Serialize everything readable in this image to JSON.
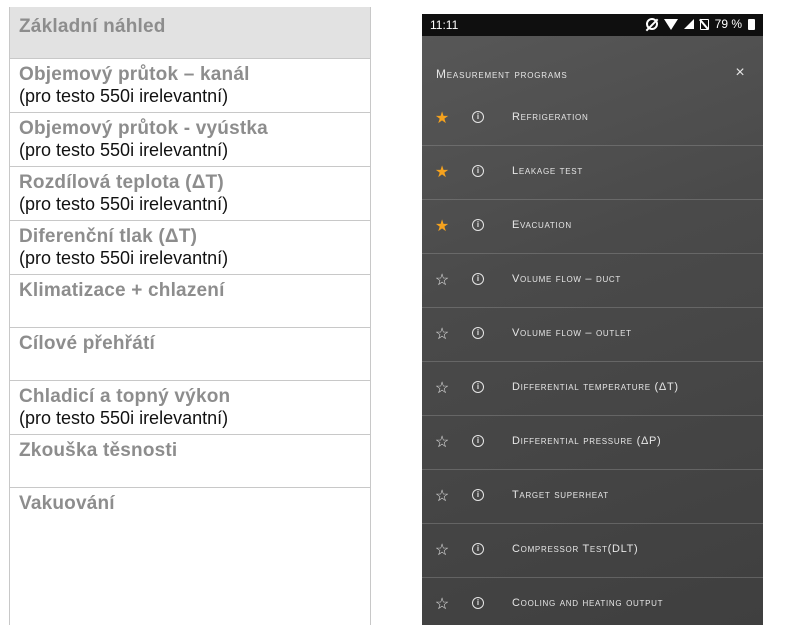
{
  "doc": {
    "header": "Základní náhled",
    "rows": [
      {
        "title": "Objemový průtok – kanál",
        "note": "(pro testo 550i irelevantní)"
      },
      {
        "title": "Objemový průtok - vyústka",
        "note": "(pro testo 550i irelevantní)"
      },
      {
        "title": "Rozdílová teplota (ΔT)",
        "note": "(pro testo 550i irelevantní)"
      },
      {
        "title": "Diferenční tlak (ΔT)",
        "note": "(pro testo 550i irelevantní)"
      },
      {
        "title": "Klimatizace + chlazení",
        "note": ""
      },
      {
        "title": "Cílové přehřátí",
        "note": ""
      },
      {
        "title": "Chladicí a topný výkon",
        "note": "(pro testo 550i irelevantní)"
      },
      {
        "title": "Zkouška těsnosti",
        "note": ""
      },
      {
        "title": "Vakuování",
        "note": ""
      }
    ]
  },
  "phone": {
    "status": {
      "time": "11:11",
      "battery": "79 %",
      "icons": [
        "alarm-off-icon",
        "wifi-icon",
        "signal-icon",
        "no-sim-icon",
        "battery-icon"
      ]
    },
    "title": "Measurement programs",
    "close_glyph": "×",
    "info_glyph": "i",
    "star_filled": "★",
    "star_empty": "☆",
    "accent_color": "#f5a21e",
    "programs": [
      {
        "label": "Refrigeration",
        "favorite": true
      },
      {
        "label": "Leakage test",
        "favorite": true
      },
      {
        "label": "Evacuation",
        "favorite": true
      },
      {
        "label": "Volume flow – duct",
        "favorite": false
      },
      {
        "label": "Volume flow – outlet",
        "favorite": false
      },
      {
        "label": "Differential temperature (ΔT)",
        "favorite": false
      },
      {
        "label": "Differential pressure (ΔP)",
        "favorite": false
      },
      {
        "label": "Target superheat",
        "favorite": false
      },
      {
        "label": "Compressor Test(DLT)",
        "favorite": false
      },
      {
        "label": "Cooling and heating output",
        "favorite": false
      }
    ]
  }
}
